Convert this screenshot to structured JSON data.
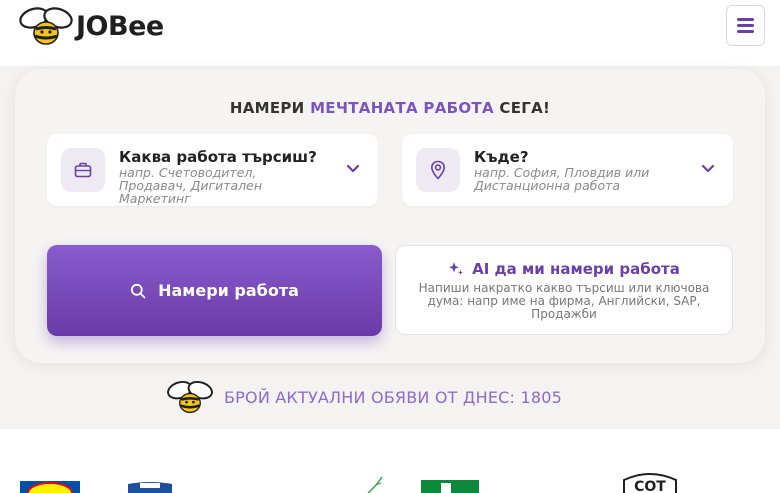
{
  "header": {
    "brand": "JOBee"
  },
  "hero": {
    "headline_pre": "НАМЕРИ",
    "headline_accent": "МЕЧТАНАТА РАБОТА",
    "headline_post": "СЕГА!",
    "job_field": {
      "label": "Каква работа търсиш?",
      "placeholder": "напр. Счетоводител, Продавач, Дигитален Маркетинг"
    },
    "location_field": {
      "label": "Къде?",
      "placeholder": "напр. София, Пловдив или Дистанционна работа"
    },
    "search_button_label": "Намери работа",
    "ai": {
      "title": "AI да ми намери работа",
      "description": "Напиши накратко какво търсиш или ключова дума: напр име на фирма, Английски, SAP, Продажби"
    }
  },
  "counter": {
    "label": "БРОЙ АКТУАЛНИ ОБЯВИ ОТ ДНЕС:",
    "count": "1805"
  },
  "partners": {
    "logos": [
      "lidl-logo",
      "sot-badge-logo",
      "leaf-logo",
      "green-logo",
      "sot-logo"
    ]
  },
  "colors": {
    "accent": "#7a55be",
    "button": "#6a3aa8",
    "bee_yellow": "#f5c518"
  }
}
